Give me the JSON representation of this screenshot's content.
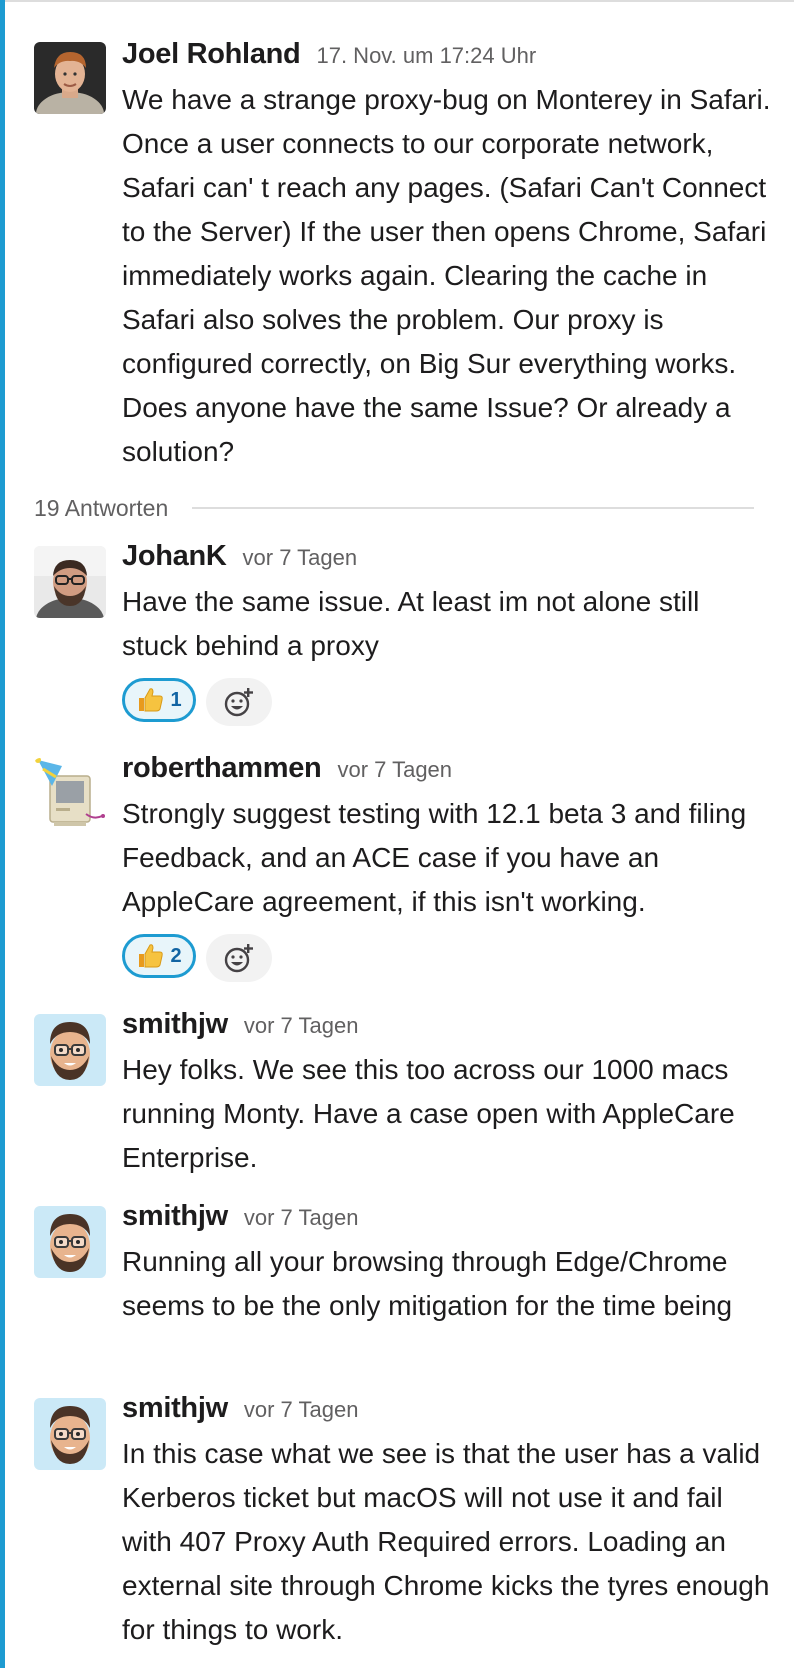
{
  "thread": {
    "parent": {
      "author": "Joel Rohland",
      "timestamp": "17. Nov. um 17:24 Uhr",
      "text": "We have a strange proxy-bug on Monterey in Safari. Once a user connects to our corporate network, Safari can' t reach any pages. (Safari Can't Connect to the Server) If the user then opens Chrome, Safari immediately works again. Clearing the cache in Safari also solves the problem. Our proxy is configured correctly, on Big Sur everything works. Does anyone have the same Issue? Or already a solution?"
    },
    "replies_label": "19 Antworten",
    "replies": [
      {
        "author": "JohanK",
        "timestamp": "vor 7 Tagen",
        "text": "Have the same issue. At least im not alone still stuck behind a proxy",
        "reaction_count": "1"
      },
      {
        "author": "roberthammen",
        "timestamp": "vor 7 Tagen",
        "text": "Strongly suggest testing with 12.1 beta 3 and filing Feedback, and an ACE case if you have an AppleCare agreement, if this isn't working.",
        "reaction_count": "2"
      },
      {
        "author": "smithjw",
        "timestamp": "vor 7 Tagen",
        "text": "Hey folks. We see this too across our 1000 macs running Monty. Have a case open with AppleCare Enterprise."
      },
      {
        "author": "smithjw",
        "timestamp": "vor 7 Tagen",
        "text": "Running all your browsing through Edge/Chrome seems to be the only mitigation for the time being"
      },
      {
        "author": "smithjw",
        "timestamp": "vor 7 Tagen",
        "text": "In this case what we see is that the user has a valid Kerberos ticket but macOS will not use it and fail with 407 Proxy Auth Required errors. Loading an external site through Chrome kicks the tyres enough for things to work."
      }
    ]
  },
  "icons": {
    "reaction_emoji": "thumbs-up-icon",
    "add_reaction": "add-reaction-icon"
  },
  "colors": {
    "accent": "#1d9bd1",
    "reaction_bg": "#e8f5fa",
    "timestamp": "#616061"
  }
}
